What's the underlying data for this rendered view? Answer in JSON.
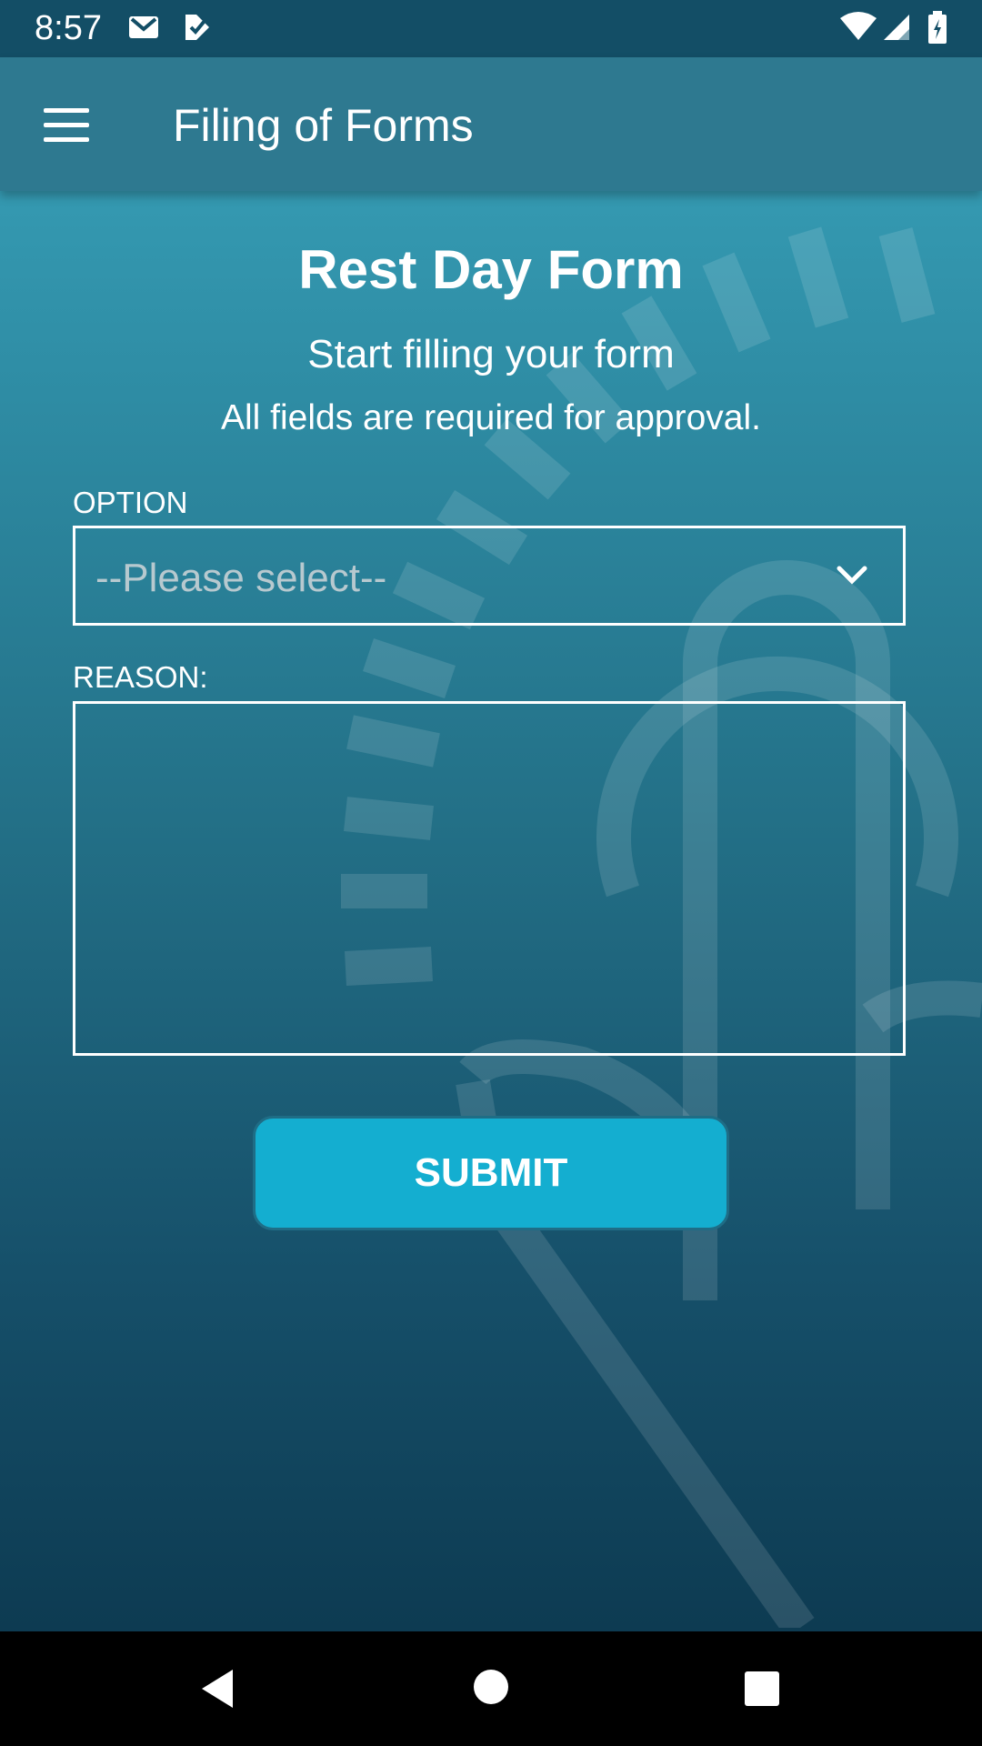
{
  "status_bar": {
    "time": "8:57",
    "left_icons": [
      "gmail-icon",
      "task-check-icon"
    ],
    "right_icons": [
      "wifi-icon",
      "cell-signal-icon",
      "battery-charging-icon"
    ]
  },
  "app_bar": {
    "menu_icon": "hamburger-menu-icon",
    "title": "Filing of Forms"
  },
  "form": {
    "title": "Rest Day Form",
    "subtitle": "Start filling your form",
    "note": "All fields are required for approval.",
    "option_label": "OPTION",
    "option_value": "--Please select--",
    "reason_label": "REASON:",
    "reason_value": "",
    "submit_label": "SUBMIT"
  },
  "nav_bar": {
    "icons": [
      "back-icon",
      "home-icon",
      "recents-icon"
    ]
  },
  "colors": {
    "status_bar": "#134e66",
    "app_bar": "#2e7990",
    "gradient_top": "#3aa5bd",
    "gradient_bottom": "#0d3b52",
    "submit_button": "#14aed0",
    "placeholder": "#b7c9cf"
  }
}
